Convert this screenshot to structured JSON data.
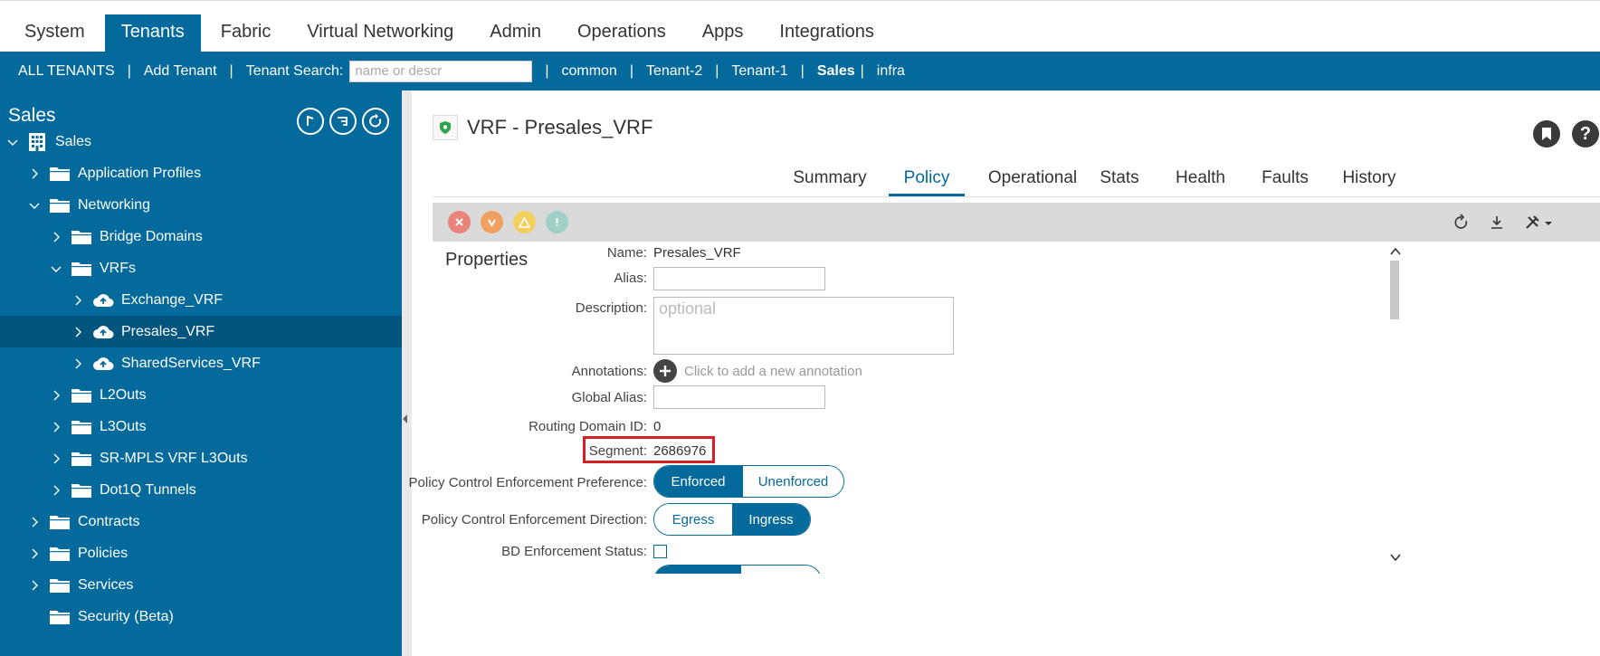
{
  "top_nav": {
    "items": [
      "System",
      "Tenants",
      "Fabric",
      "Virtual Networking",
      "Admin",
      "Operations",
      "Apps",
      "Integrations"
    ],
    "active": "Tenants"
  },
  "sub_nav": {
    "all_tenants": "ALL TENANTS",
    "add_tenant": "Add Tenant",
    "tenant_search_label": "Tenant Search:",
    "tenant_search_placeholder": "name or descr",
    "tenants": [
      "common",
      "Tenant-2",
      "Tenant-1",
      "Sales",
      "infra"
    ],
    "active_tenant": "Sales",
    "separator": "|"
  },
  "left_panel": {
    "title": "Sales",
    "buttons": [
      "quick-start-icon",
      "list-filter-icon",
      "refresh-icon"
    ],
    "tree": [
      {
        "label": "Sales",
        "level": 0,
        "icon": "tenant-icon",
        "expanded": true
      },
      {
        "label": "Application Profiles",
        "level": 1,
        "icon": "folder-icon",
        "expanded": false
      },
      {
        "label": "Networking",
        "level": 1,
        "icon": "folder-icon",
        "expanded": true
      },
      {
        "label": "Bridge Domains",
        "level": 2,
        "icon": "folder-icon",
        "expanded": false
      },
      {
        "label": "VRFs",
        "level": 2,
        "icon": "folder-icon",
        "expanded": true
      },
      {
        "label": "Exchange_VRF",
        "level": 3,
        "icon": "cloud-icon",
        "expanded": false
      },
      {
        "label": "Presales_VRF",
        "level": 3,
        "icon": "cloud-icon",
        "expanded": false,
        "selected": true
      },
      {
        "label": "SharedServices_VRF",
        "level": 3,
        "icon": "cloud-icon",
        "expanded": false
      },
      {
        "label": "L2Outs",
        "level": 2,
        "icon": "folder-icon",
        "expanded": false
      },
      {
        "label": "L3Outs",
        "level": 2,
        "icon": "folder-icon",
        "expanded": false
      },
      {
        "label": "SR-MPLS VRF L3Outs",
        "level": 2,
        "icon": "folder-icon",
        "expanded": false
      },
      {
        "label": "Dot1Q Tunnels",
        "level": 2,
        "icon": "folder-icon",
        "expanded": false
      },
      {
        "label": "Contracts",
        "level": 1,
        "icon": "folder-icon",
        "expanded": false
      },
      {
        "label": "Policies",
        "level": 1,
        "icon": "folder-icon",
        "expanded": false
      },
      {
        "label": "Services",
        "level": 1,
        "icon": "folder-icon",
        "expanded": false
      },
      {
        "label": "Security (Beta)",
        "level": 1,
        "icon": "folder-icon",
        "expanded": null
      }
    ]
  },
  "main": {
    "title": "VRF - Presales_VRF",
    "tabs": [
      "Summary",
      "Policy",
      "Operational",
      "Stats",
      "Health",
      "Faults",
      "History"
    ],
    "active_tab": "Policy",
    "properties_title": "Properties",
    "fields": {
      "name_label": "Name:",
      "name_value": "Presales_VRF",
      "alias_label": "Alias:",
      "alias_value": "",
      "description_label": "Description:",
      "description_placeholder": "optional",
      "annotations_label": "Annotations:",
      "annotations_hint": "Click to add a new annotation",
      "global_alias_label": "Global Alias:",
      "global_alias_value": "",
      "routing_domain_label": "Routing Domain ID:",
      "routing_domain_value": "0",
      "segment_label": "Segment:",
      "segment_value": "2686976",
      "pce_pref_label": "Policy Control Enforcement Preference:",
      "pce_pref_options": [
        "Enforced",
        "Unenforced"
      ],
      "pce_pref_selected": "Enforced",
      "pce_dir_label": "Policy Control Enforcement Direction:",
      "pce_dir_options": [
        "Egress",
        "Ingress"
      ],
      "pce_dir_selected": "Ingress",
      "bd_enforcement_label": "BD Enforcement Status:",
      "bd_enforcement_checked": false
    }
  },
  "colors": {
    "brand": "#04699b",
    "selected_row": "#03557d",
    "highlight": "#d32027",
    "fault_critical": "#e8847a",
    "fault_major": "#f0a060",
    "fault_minor": "#f2cf5e",
    "fault_warning": "#9fd0c8"
  }
}
